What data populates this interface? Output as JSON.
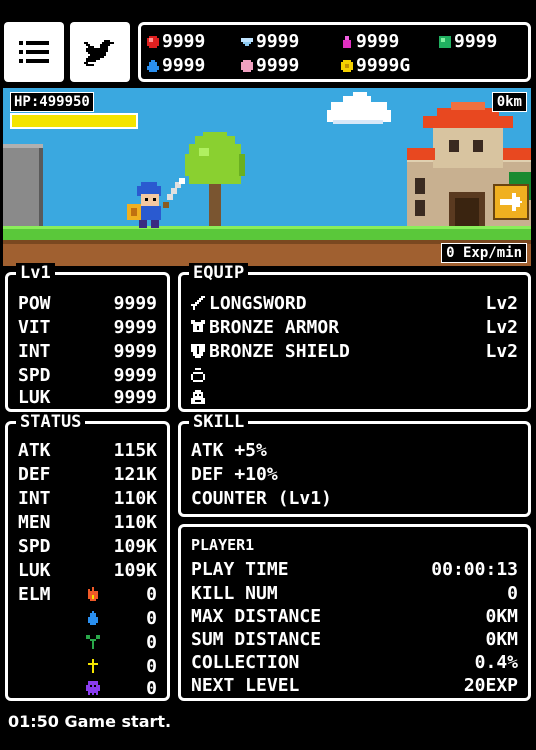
{
  "resources": {
    "top": [
      {
        "icon": "red-gem-icon",
        "value": "9999"
      },
      {
        "icon": "diamond-icon",
        "value": "9999"
      },
      {
        "icon": "potion-icon",
        "value": "9999"
      },
      {
        "icon": "green-gem-icon",
        "value": "9999"
      }
    ],
    "bottom": [
      {
        "icon": "water-drop-icon",
        "value": "9999"
      },
      {
        "icon": "pink-orb-icon",
        "value": "9999"
      },
      {
        "icon": "gold-coin-icon",
        "value": "9999G"
      }
    ]
  },
  "scene": {
    "hp_label": "HP:499950",
    "hp_fraction": 1.0,
    "distance": "0km",
    "exp_rate": "0 Exp/min"
  },
  "level_panel": {
    "title": "Lv1",
    "stats": [
      {
        "label": "POW",
        "value": "9999"
      },
      {
        "label": "VIT",
        "value": "9999"
      },
      {
        "label": "INT",
        "value": "9999"
      },
      {
        "label": "SPD",
        "value": "9999"
      },
      {
        "label": "LUK",
        "value": "9999"
      }
    ]
  },
  "equip_panel": {
    "title": "EQUIP",
    "items": [
      {
        "icon": "sword-icon",
        "name": "LONGSWORD",
        "level": "Lv2"
      },
      {
        "icon": "armor-icon",
        "name": "BRONZE ARMOR",
        "level": "Lv2"
      },
      {
        "icon": "shield-icon",
        "name": "BRONZE SHIELD",
        "level": "Lv2"
      },
      {
        "icon": "ring-icon",
        "name": "",
        "level": ""
      },
      {
        "icon": "amulet-icon",
        "name": "",
        "level": ""
      }
    ]
  },
  "status_panel": {
    "title": "STATUS",
    "stats": [
      {
        "label": "ATK",
        "value": "115K"
      },
      {
        "label": "DEF",
        "value": "121K"
      },
      {
        "label": "INT",
        "value": "110K"
      },
      {
        "label": "MEN",
        "value": "110K"
      },
      {
        "label": "SPD",
        "value": "109K"
      },
      {
        "label": "LUK",
        "value": "109K"
      }
    ],
    "elm_label": "ELM",
    "elements": [
      {
        "icon": "fire-icon",
        "color": "#f05a28",
        "value": "0"
      },
      {
        "icon": "water-icon",
        "color": "#2a8ff0",
        "value": "0"
      },
      {
        "icon": "plant-icon",
        "color": "#2aa84a",
        "value": "0"
      },
      {
        "icon": "holy-cross-icon",
        "color": "#f4e400",
        "value": "0"
      },
      {
        "icon": "ghost-icon",
        "color": "#8a3cf0",
        "value": "0"
      }
    ]
  },
  "skill_panel": {
    "title": "SKILL",
    "skills": [
      "ATK +5%",
      "DEF +10%",
      "COUNTER (Lv1)"
    ]
  },
  "player_panel": {
    "name": "PLAYER1",
    "rows": [
      {
        "label": "PLAY TIME",
        "value": "00:00:13"
      },
      {
        "label": "KILL NUM",
        "value": "0"
      },
      {
        "label": "MAX DISTANCE",
        "value": "0KM"
      },
      {
        "label": "SUM DISTANCE",
        "value": "0KM"
      },
      {
        "label": "COLLECTION",
        "value": "0.4%"
      },
      {
        "label": "NEXT LEVEL",
        "value": "20EXP"
      }
    ]
  },
  "log": "01:50 Game start."
}
